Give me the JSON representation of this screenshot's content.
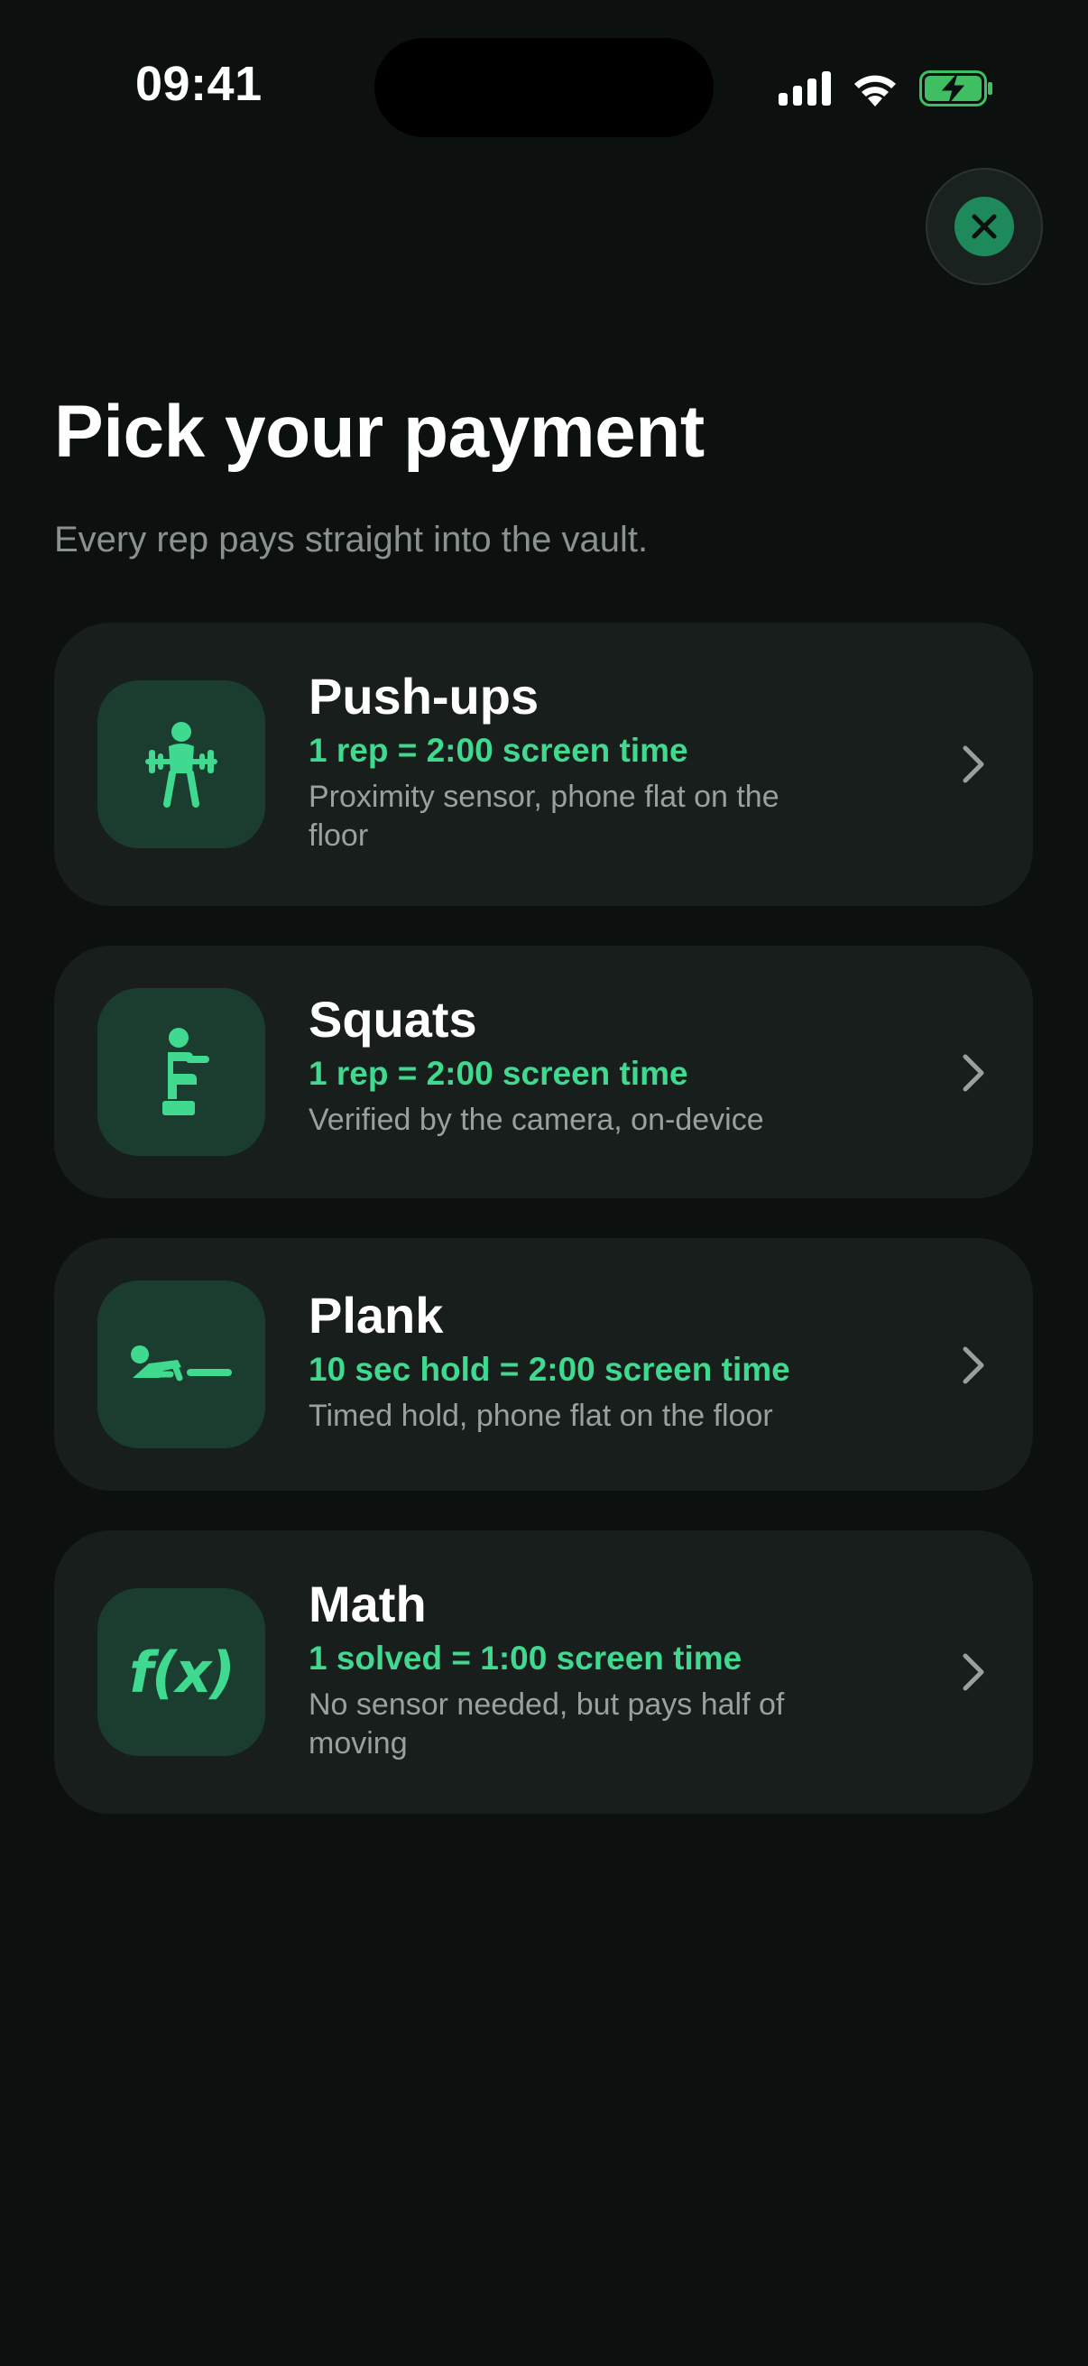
{
  "status_bar": {
    "time": "09:41",
    "icons": [
      "signal-icon",
      "wifi-icon",
      "battery-charging-icon"
    ]
  },
  "close_button": {
    "icon": "close-icon"
  },
  "header": {
    "title": "Pick your payment",
    "subtitle": "Every rep pays straight into the vault."
  },
  "options": [
    {
      "title": "Push-ups",
      "rate": "1 rep = 2:00 screen time",
      "description": "Proximity sensor, phone flat on the floor",
      "icon": "weightlifting-icon"
    },
    {
      "title": "Squats",
      "rate": "1 rep = 2:00 screen time",
      "description": "Verified by the camera, on-device",
      "icon": "squat-icon"
    },
    {
      "title": "Plank",
      "rate": "10 sec hold = 2:00 screen time",
      "description": "Timed hold, phone flat on the floor",
      "icon": "plank-icon"
    },
    {
      "title": "Math",
      "rate": "1 solved = 1:00 screen time",
      "description": "No sensor needed, but pays half of moving",
      "icon": "function-icon",
      "icon_text": "f(x)"
    }
  ],
  "colors": {
    "background": "#0c1110",
    "card": "#171e1c",
    "icon_tile": "#1b3d2f",
    "accent": "#3fd98f",
    "secondary_text": "#9aa09e"
  }
}
